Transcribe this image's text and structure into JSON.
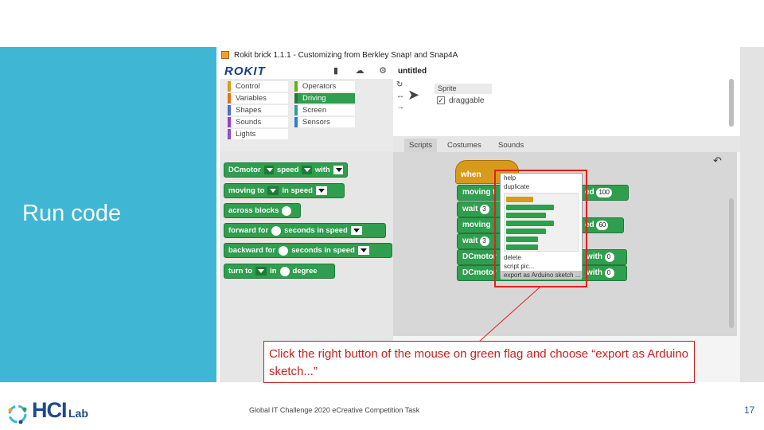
{
  "slide": {
    "title": "Run code",
    "footer": "Global IT Challenge 2020 eCreative Competition Task",
    "page_number": "17",
    "callout": "Click the right button of the mouse on green flag and choose “export as Arduino sketch...”",
    "logo_text": "HCI",
    "logo_suffix": "Lab"
  },
  "app": {
    "window_title": "Rokit brick 1.1.1 - Customizing from Berkley Snap! and Snap4A",
    "logo": "ROKIT",
    "project_name": "untitled",
    "categories_left": [
      "Control",
      "Variables",
      "Shapes",
      "Sounds",
      "Lights"
    ],
    "categories_right": [
      "Operators",
      "Driving",
      "Screen",
      "Sensors"
    ],
    "selected_category": "Driving",
    "palette_blocks": [
      {
        "parts": [
          "DCmotor",
          "speed",
          "with"
        ]
      },
      {
        "parts": [
          "moving to",
          "in speed"
        ]
      },
      {
        "parts": [
          "across blocks"
        ]
      },
      {
        "parts": [
          "forward for",
          "seconds in speed"
        ]
      },
      {
        "parts": [
          "backward for",
          "seconds in speed"
        ]
      },
      {
        "parts": [
          "turn to",
          "in",
          "degree"
        ]
      }
    ],
    "sprite": {
      "name": "Sprite",
      "draggable_label": "draggable"
    },
    "tabs": [
      "Scripts",
      "Costumes",
      "Sounds"
    ],
    "selected_tab": "Scripts",
    "script": {
      "hat": "when",
      "blocks": [
        "moving t",
        "wait",
        "moving",
        "wait",
        "DCmotor",
        "DCmotor"
      ],
      "right_labels": [
        "ed",
        "ed",
        "with",
        "with"
      ],
      "right_values": [
        "100",
        "60",
        "0",
        "0"
      ],
      "wait_values": [
        "3",
        "3"
      ]
    },
    "context_menu": [
      "help",
      "duplicate",
      "delete",
      "script pic...",
      "export as Arduino sketch ..."
    ],
    "highlighted_menu_item": "export as Arduino sketch ..."
  },
  "colors": {
    "band": "#3fb6d3",
    "accent_red": "#e02020",
    "block_green": "#2f9e4e",
    "hat_orange": "#d89a1a"
  }
}
